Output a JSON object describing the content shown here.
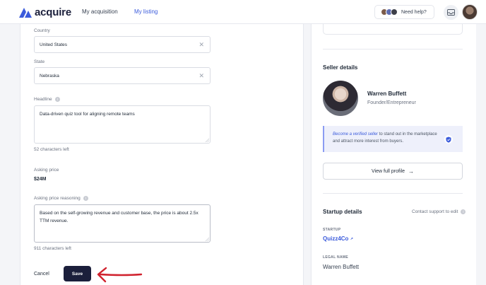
{
  "header": {
    "brand": "acquire",
    "nav": [
      {
        "label": "My acquisition",
        "active": false
      },
      {
        "label": "My listing",
        "active": true
      }
    ],
    "help_label": "Need help?",
    "icons": {
      "inbox": "inbox-icon",
      "avatar": "user-avatar"
    }
  },
  "form": {
    "country_label": "Country",
    "country_value": "United States",
    "state_label": "State",
    "state_value": "Nebraska",
    "headline_label": "Headline",
    "headline_value": "Data-driven quiz tool for aligning remote teams",
    "headline_hint": "52 characters left",
    "asking_price_label": "Asking price",
    "asking_price_value": "$24M",
    "reasoning_label": "Asking price reasoning",
    "reasoning_value": "Based on the self-growing revenue and customer base, the price is about 2.5x TTM revenue.",
    "reasoning_hint": "911 characters left",
    "cancel_label": "Cancel",
    "save_label": "Save"
  },
  "seller": {
    "title": "Seller details",
    "name": "Warren Buffett",
    "role": "Founder/Entrepreneur",
    "verify_link": "Become a verified seller",
    "verify_rest": " to stand out in the marketplace and attract more interest from buyers.",
    "view_profile_label": "View full profile"
  },
  "startup": {
    "title": "Startup details",
    "contact_label": "Contact support to edit",
    "startup_cap": "STARTUP",
    "startup_name": "Quizz4Co",
    "legal_cap": "LEGAL NAME",
    "legal_name": "Warren Buffett"
  },
  "colors": {
    "accent": "#3b5bdb",
    "brand_dark": "#1b1f3b",
    "annotation_arrow": "#d0222e"
  }
}
